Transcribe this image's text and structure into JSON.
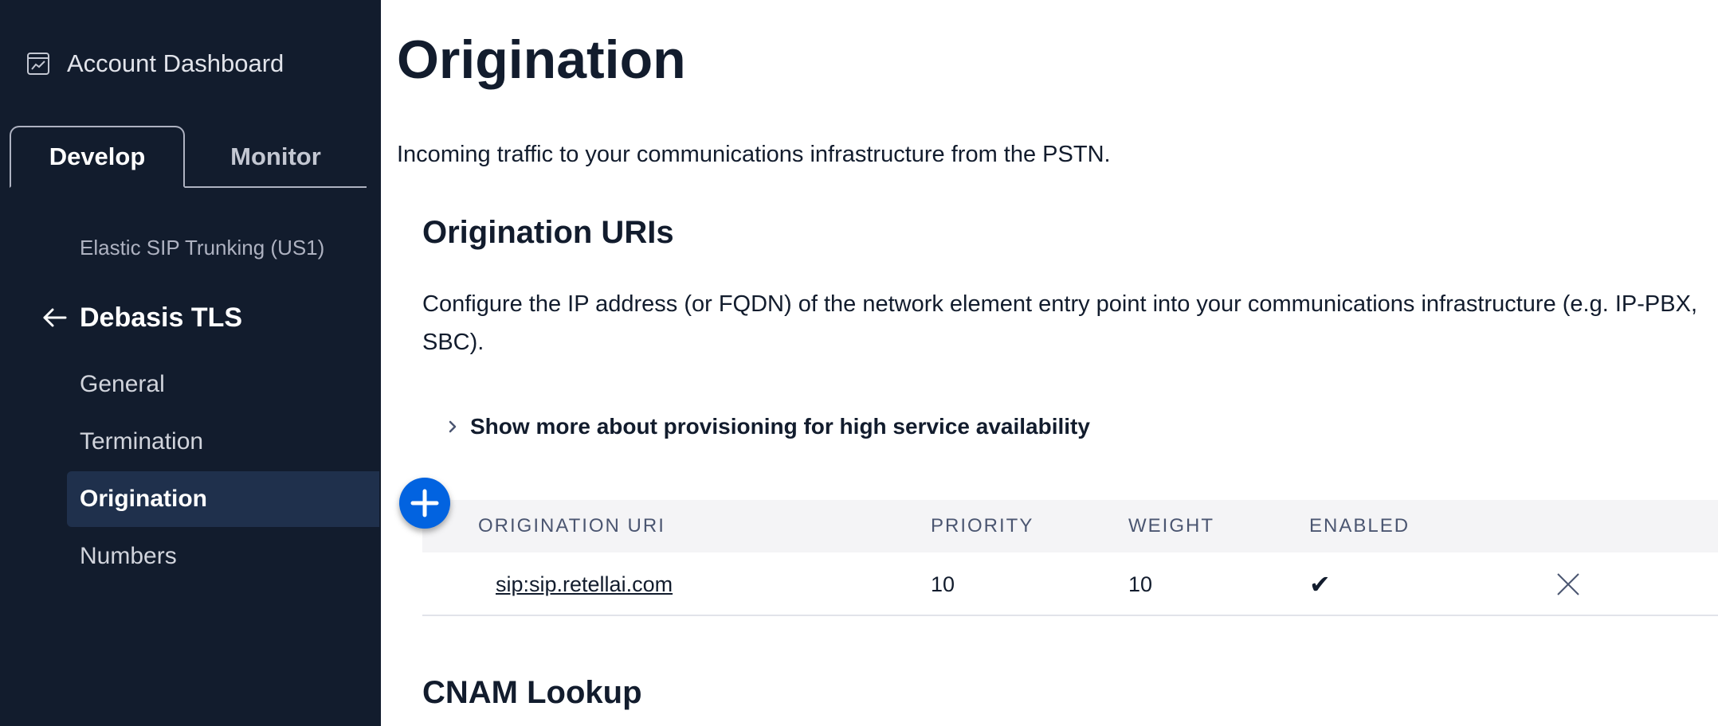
{
  "sidebar": {
    "account_link": {
      "label": "Account Dashboard",
      "icon": "chart-icon"
    },
    "tabs": [
      {
        "label": "Develop",
        "active": true
      },
      {
        "label": "Monitor",
        "active": false
      }
    ],
    "breadcrumb": "Elastic SIP Trunking (US1)",
    "trunk_name": "Debasis TLS",
    "nav_items": [
      {
        "label": "General",
        "active": false
      },
      {
        "label": "Termination",
        "active": false
      },
      {
        "label": "Origination",
        "active": true
      },
      {
        "label": "Numbers",
        "active": false
      }
    ]
  },
  "main": {
    "title": "Origination",
    "description": "Incoming traffic to your communications infrastructure from the PSTN.",
    "uris_section": {
      "heading": "Origination URIs",
      "description": "Configure the IP address (or FQDN) of the network element entry point into your communications infrastructure (e.g. IP-PBX, SBC).",
      "show_more": "Show more about provisioning for high service availability",
      "table": {
        "headers": [
          "ORIGINATION URI",
          "PRIORITY",
          "WEIGHT",
          "ENABLED"
        ],
        "rows": [
          {
            "uri": "sip:sip.retellai.com",
            "priority": "10",
            "weight": "10",
            "enabled": "✔"
          }
        ]
      }
    },
    "cnam_heading": "CNAM Lookup"
  },
  "colors": {
    "sidebar_bg": "#121c2d",
    "active_nav_bg": "#1f304c",
    "accent": "#0263e0",
    "table_header_bg": "#f4f4f6"
  }
}
